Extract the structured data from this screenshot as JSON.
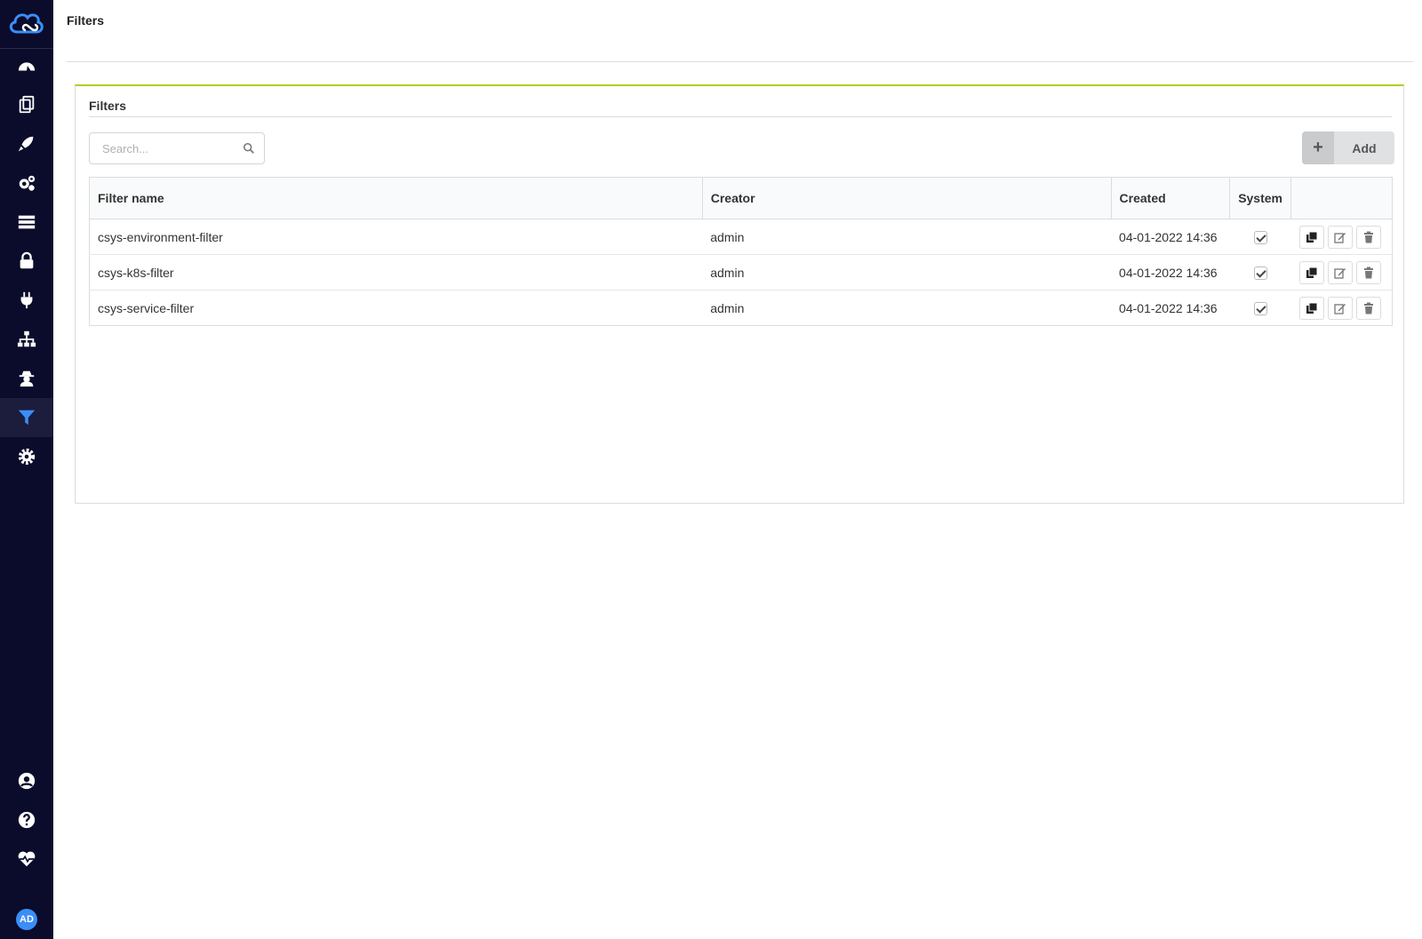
{
  "app": {
    "page_title": "Filters",
    "user_initials": "AD"
  },
  "sidebar": {
    "items": [
      {
        "icon": "dashboard-icon"
      },
      {
        "icon": "copy-icon"
      },
      {
        "icon": "rocket-icon"
      },
      {
        "icon": "cogs-icon"
      },
      {
        "icon": "server-icon"
      },
      {
        "icon": "lock-icon"
      },
      {
        "icon": "plug-icon"
      },
      {
        "icon": "sitemap-icon"
      },
      {
        "icon": "user-secret-icon"
      },
      {
        "icon": "filter-icon",
        "active": true
      },
      {
        "icon": "gear-icon"
      }
    ],
    "bottom_items": [
      {
        "icon": "user-circle-icon"
      },
      {
        "icon": "question-circle-icon"
      },
      {
        "icon": "heartbeat-icon"
      }
    ],
    "active_color": "#3a8ef6"
  },
  "panel": {
    "title": "Filters",
    "accent_color": "#b5cc18",
    "search": {
      "placeholder": "Search..."
    },
    "add_label": "Add",
    "add_icon": "+"
  },
  "table": {
    "headers": {
      "name": "Filter name",
      "creator": "Creator",
      "created": "Created",
      "system": "System"
    },
    "rows": [
      {
        "name": "csys-environment-filter",
        "creator": "admin",
        "created": "04-01-2022 14:36",
        "system": true
      },
      {
        "name": "csys-k8s-filter",
        "creator": "admin",
        "created": "04-01-2022 14:36",
        "system": true
      },
      {
        "name": "csys-service-filter",
        "creator": "admin",
        "created": "04-01-2022 14:36",
        "system": true
      }
    ]
  }
}
